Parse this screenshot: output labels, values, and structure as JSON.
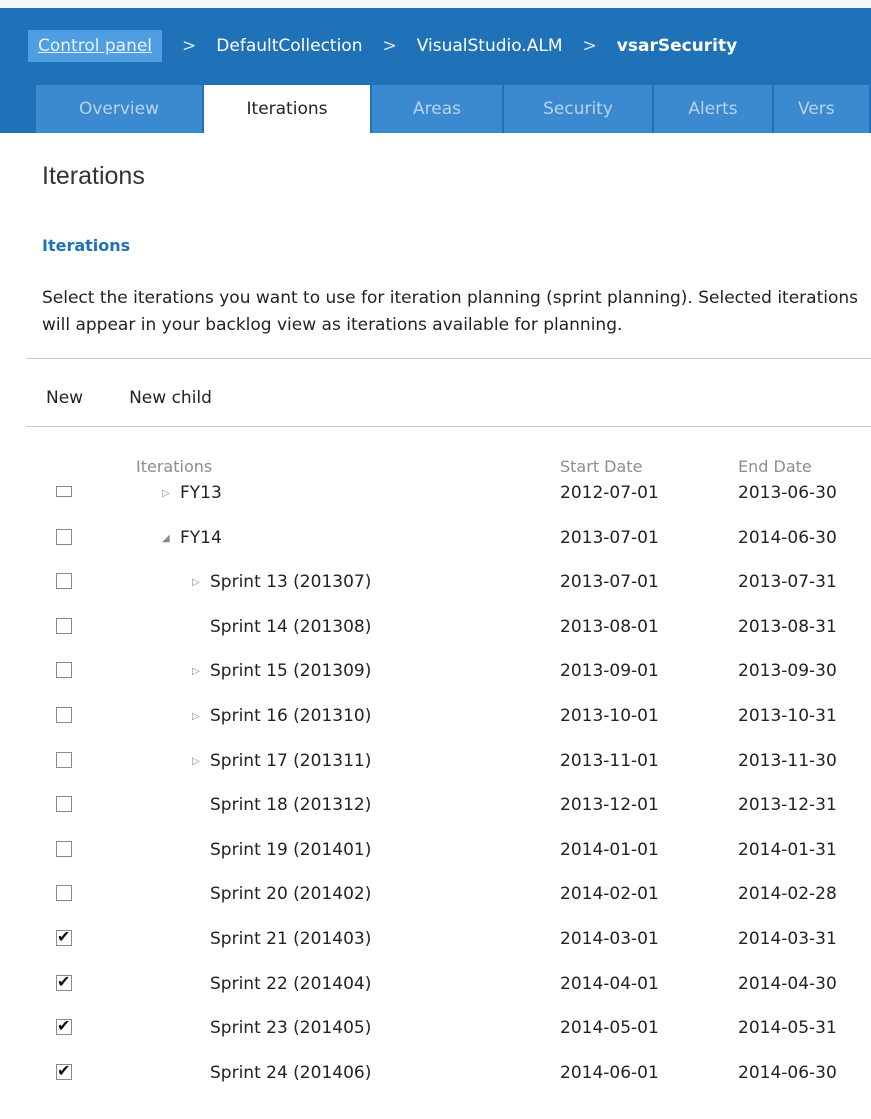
{
  "breadcrumb": [
    "Control panel",
    "DefaultCollection",
    "VisualStudio.ALM",
    "vsarSecurity"
  ],
  "breadcrumb_sep": ">",
  "tabs": [
    "Overview",
    "Iterations",
    "Areas",
    "Security",
    "Alerts",
    "Vers"
  ],
  "active_tab": "Iterations",
  "page_title": "Iterations",
  "section_title": "Iterations",
  "description": "Select the iterations you want to use for iteration planning (sprint planning). Selected iterations will appear in your backlog view as iterations available for planning.",
  "toolbar": {
    "new_label": "New",
    "new_child_label": "New child"
  },
  "columns": {
    "iterations": "Iterations",
    "start": "Start Date",
    "end": "End Date"
  },
  "rows": [
    {
      "name": "FY13",
      "start": "2012-07-01",
      "end": "2013-06-30",
      "checked": false,
      "level": 1,
      "toggle": "collapsed"
    },
    {
      "name": "FY14",
      "start": "2013-07-01",
      "end": "2014-06-30",
      "checked": false,
      "level": 1,
      "toggle": "expanded"
    },
    {
      "name": "Sprint 13 (201307)",
      "start": "2013-07-01",
      "end": "2013-07-31",
      "checked": false,
      "level": 2,
      "toggle": "collapsed"
    },
    {
      "name": "Sprint 14 (201308)",
      "start": "2013-08-01",
      "end": "2013-08-31",
      "checked": false,
      "level": 2,
      "toggle": "none"
    },
    {
      "name": "Sprint 15 (201309)",
      "start": "2013-09-01",
      "end": "2013-09-30",
      "checked": false,
      "level": 2,
      "toggle": "collapsed"
    },
    {
      "name": "Sprint 16 (201310)",
      "start": "2013-10-01",
      "end": "2013-10-31",
      "checked": false,
      "level": 2,
      "toggle": "collapsed"
    },
    {
      "name": "Sprint 17 (201311)",
      "start": "2013-11-01",
      "end": "2013-11-30",
      "checked": false,
      "level": 2,
      "toggle": "collapsed"
    },
    {
      "name": "Sprint 18 (201312)",
      "start": "2013-12-01",
      "end": "2013-12-31",
      "checked": false,
      "level": 2,
      "toggle": "none"
    },
    {
      "name": "Sprint 19 (201401)",
      "start": "2014-01-01",
      "end": "2014-01-31",
      "checked": false,
      "level": 2,
      "toggle": "none"
    },
    {
      "name": "Sprint 20 (201402)",
      "start": "2014-02-01",
      "end": "2014-02-28",
      "checked": false,
      "level": 2,
      "toggle": "none"
    },
    {
      "name": "Sprint 21 (201403)",
      "start": "2014-03-01",
      "end": "2014-03-31",
      "checked": true,
      "level": 2,
      "toggle": "none"
    },
    {
      "name": "Sprint 22 (201404)",
      "start": "2014-04-01",
      "end": "2014-04-30",
      "checked": true,
      "level": 2,
      "toggle": "none"
    },
    {
      "name": "Sprint 23 (201405)",
      "start": "2014-05-01",
      "end": "2014-05-31",
      "checked": true,
      "level": 2,
      "toggle": "none"
    },
    {
      "name": "Sprint 24 (201406)",
      "start": "2014-06-01",
      "end": "2014-06-30",
      "checked": true,
      "level": 2,
      "toggle": "none"
    }
  ],
  "colors": {
    "header_blue": "#1f72b8",
    "tab_blue": "#3b8ad0",
    "crumb_highlight": "#4e9ee1",
    "section_title": "#1f72b8"
  }
}
